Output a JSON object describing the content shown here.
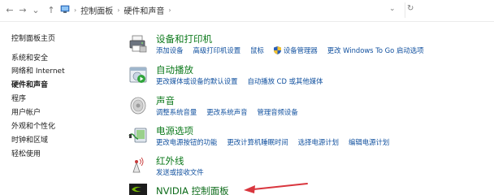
{
  "address_bar": {
    "breadcrumbs": [
      "控制面板",
      "硬件和声音"
    ]
  },
  "left_nav": {
    "home": "控制面板主页",
    "items": [
      {
        "label": "系统和安全",
        "active": false
      },
      {
        "label": "网络和 Internet",
        "active": false
      },
      {
        "label": "硬件和声音",
        "active": true
      },
      {
        "label": "程序",
        "active": false
      },
      {
        "label": "用户帐户",
        "active": false
      },
      {
        "label": "外观和个性化",
        "active": false
      },
      {
        "label": "时钟和区域",
        "active": false
      },
      {
        "label": "轻松使用",
        "active": false
      }
    ]
  },
  "categories": [
    {
      "title": "设备和打印机",
      "icon": "printer-icon",
      "links": [
        {
          "label": "添加设备",
          "shield": false
        },
        {
          "label": "高级打印机设置",
          "shield": false
        },
        {
          "label": "鼠标",
          "shield": false
        },
        {
          "label": "设备管理器",
          "shield": true
        },
        {
          "label": "更改 Windows To Go 启动选项",
          "shield": false
        }
      ]
    },
    {
      "title": "自动播放",
      "icon": "autoplay-icon",
      "links": [
        {
          "label": "更改媒体或设备的默认设置",
          "shield": false
        },
        {
          "label": "自动播放 CD 或其他媒体",
          "shield": false
        }
      ]
    },
    {
      "title": "声音",
      "icon": "speaker-icon",
      "links": [
        {
          "label": "调整系统音量",
          "shield": false
        },
        {
          "label": "更改系统声音",
          "shield": false
        },
        {
          "label": "管理音频设备",
          "shield": false
        }
      ]
    },
    {
      "title": "电源选项",
      "icon": "power-icon",
      "links": [
        {
          "label": "更改电源按钮的功能",
          "shield": false
        },
        {
          "label": "更改计算机睡眠时间",
          "shield": false
        },
        {
          "label": "选择电源计划",
          "shield": false
        },
        {
          "label": "编辑电源计划",
          "shield": false
        }
      ]
    },
    {
      "title": "红外线",
      "icon": "infrared-icon",
      "links": [
        {
          "label": "发送或接收文件",
          "shield": false
        }
      ]
    },
    {
      "title": "NVIDIA 控制面板",
      "icon": "nvidia-icon",
      "links": []
    }
  ],
  "colors": {
    "category_title": "#0e7a1d",
    "link": "#0f4f9e",
    "annotation_arrow": "#d9363e"
  }
}
